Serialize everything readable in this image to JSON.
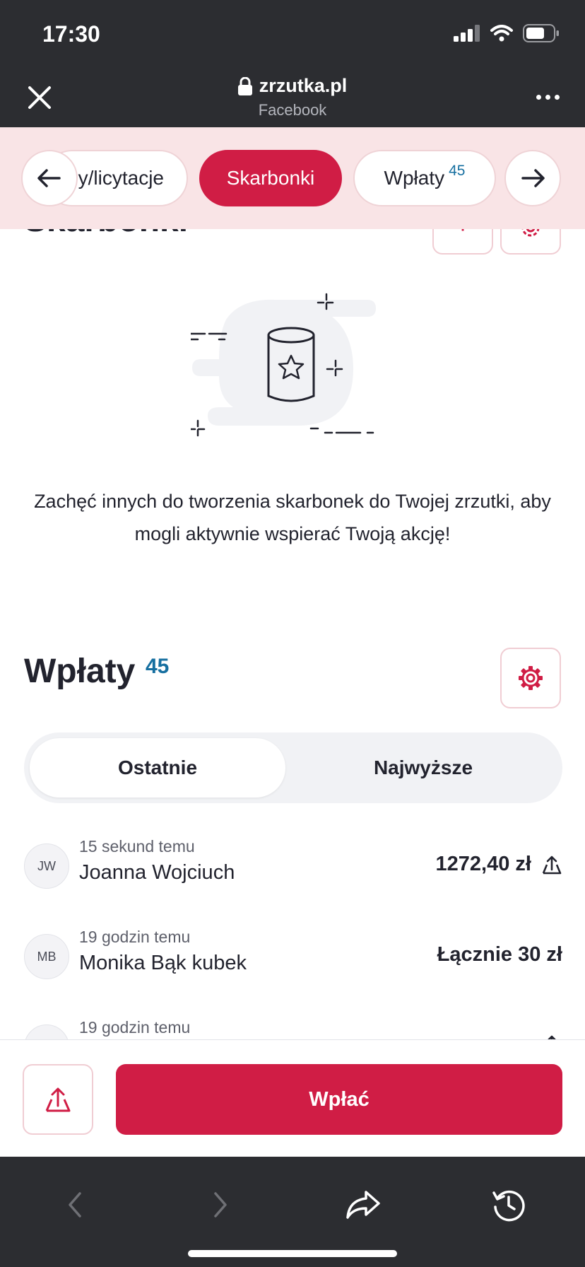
{
  "status_bar": {
    "time": "17:30"
  },
  "browser": {
    "domain": "zrzutka.pl",
    "source": "Facebook"
  },
  "section_tabs": {
    "items": [
      {
        "label": "y/licytacje",
        "count": ""
      },
      {
        "label": "Skarbonki",
        "count": ""
      },
      {
        "label": "Wpłaty",
        "count": "45"
      }
    ],
    "active": "Skarbonki"
  },
  "piggybanks": {
    "title": "Skarbonki",
    "empty_text": "Zachęć innych do tworzenia skarbonek do Twojej zrzutki, aby mogli aktywnie wspierać Twoją akcję!",
    "add_symbol": "+"
  },
  "payments": {
    "title": "Wpłaty",
    "count": "45",
    "tabs": [
      "Ostatnie",
      "Najwyższe"
    ],
    "active_tab": "Ostatnie",
    "rows": [
      {
        "initials": "JW",
        "time": "15 sekund temu",
        "name": "Joanna Wojciuch",
        "amount": "1272,40 zł",
        "icon": "share-icon"
      },
      {
        "initials": "MB",
        "time": "19 godzin temu",
        "name": "Monika Bąk kubek",
        "amount": "Łącznie 30 zł",
        "icon": ""
      },
      {
        "initials": "",
        "time": "19 godzin temu",
        "name": "",
        "amount": "",
        "icon": "share-icon"
      }
    ]
  },
  "actions": {
    "pay_label": "Wpłać"
  },
  "colors": {
    "brand": "#d01d45",
    "accent_count": "#166fa0",
    "chrome": "#2c2d31",
    "tabs_bg": "#f9e4e6"
  }
}
